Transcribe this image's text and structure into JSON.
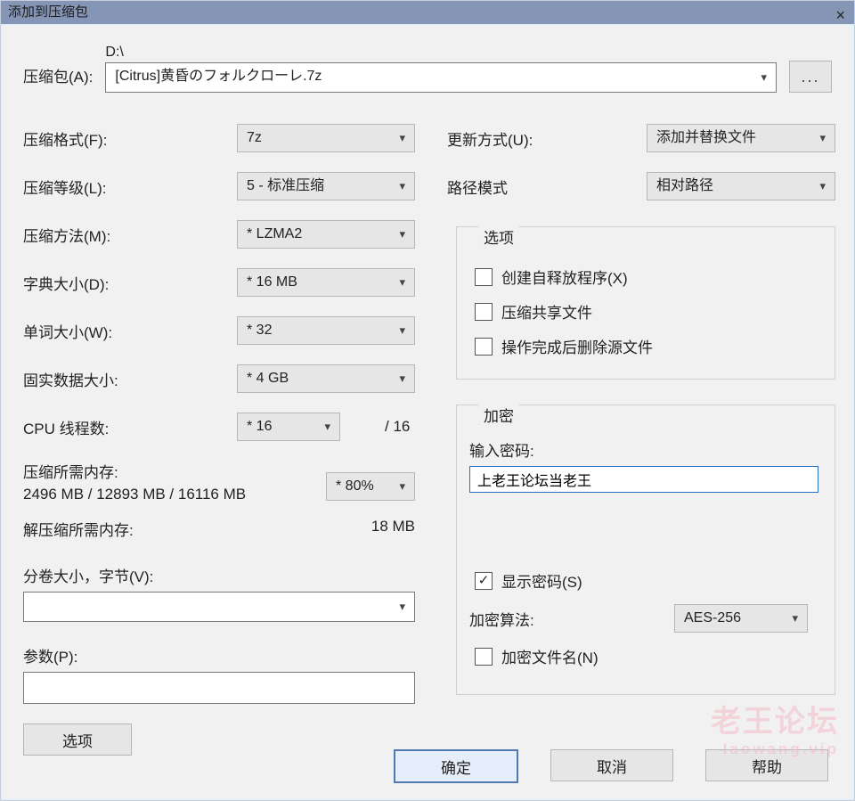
{
  "window": {
    "title": "添加到压缩包",
    "close": "×"
  },
  "archive": {
    "label": "压缩包(A):",
    "pathDir": "D:\\",
    "filename": "[Citrus]黄昏のフォルクローレ.7z",
    "browse": "..."
  },
  "left": {
    "format": {
      "label": "压缩格式(F):",
      "value": "7z"
    },
    "level": {
      "label": "压缩等级(L):",
      "value": "5 - 标准压缩"
    },
    "method": {
      "label": "压缩方法(M):",
      "value": "*  LZMA2"
    },
    "dict": {
      "label": "字典大小(D):",
      "value": "*  16 MB"
    },
    "word": {
      "label": "单词大小(W):",
      "value": "*  32"
    },
    "solid": {
      "label": "固实数据大小:",
      "value": "*  4 GB"
    },
    "threads": {
      "label": "CPU 线程数:",
      "value": "*  16",
      "total": "/ 16"
    },
    "memComp": {
      "label": "压缩所需内存:",
      "value": "2496 MB / 12893 MB / 16116 MB",
      "boxValue": "*  80%"
    },
    "memDecomp": {
      "label": "解压缩所需内存:",
      "value": "18 MB"
    },
    "split": {
      "label": "分卷大小，字节(V):",
      "value": ""
    },
    "params": {
      "label": "参数(P):",
      "value": ""
    },
    "optionsBtn": "选项"
  },
  "right": {
    "update": {
      "label": "更新方式(U):",
      "value": "添加并替换文件"
    },
    "pathMode": {
      "label": "路径模式",
      "value": "相对路径"
    },
    "options": {
      "legend": "选项",
      "sfx": "创建自释放程序(X)",
      "shared": "压缩共享文件",
      "deleteAfter": "操作完成后删除源文件"
    },
    "encrypt": {
      "legend": "加密",
      "pwdLabel": "输入密码:",
      "pwdValue": "上老王论坛当老王",
      "showPwd": "显示密码(S)",
      "algoLabel": "加密算法:",
      "algoValue": "AES-256",
      "encNames": "加密文件名(N)"
    }
  },
  "footer": {
    "ok": "确定",
    "cancel": "取消",
    "help": "帮助"
  },
  "watermark": {
    "cn": "老王论坛",
    "en": "laowang.vip"
  }
}
